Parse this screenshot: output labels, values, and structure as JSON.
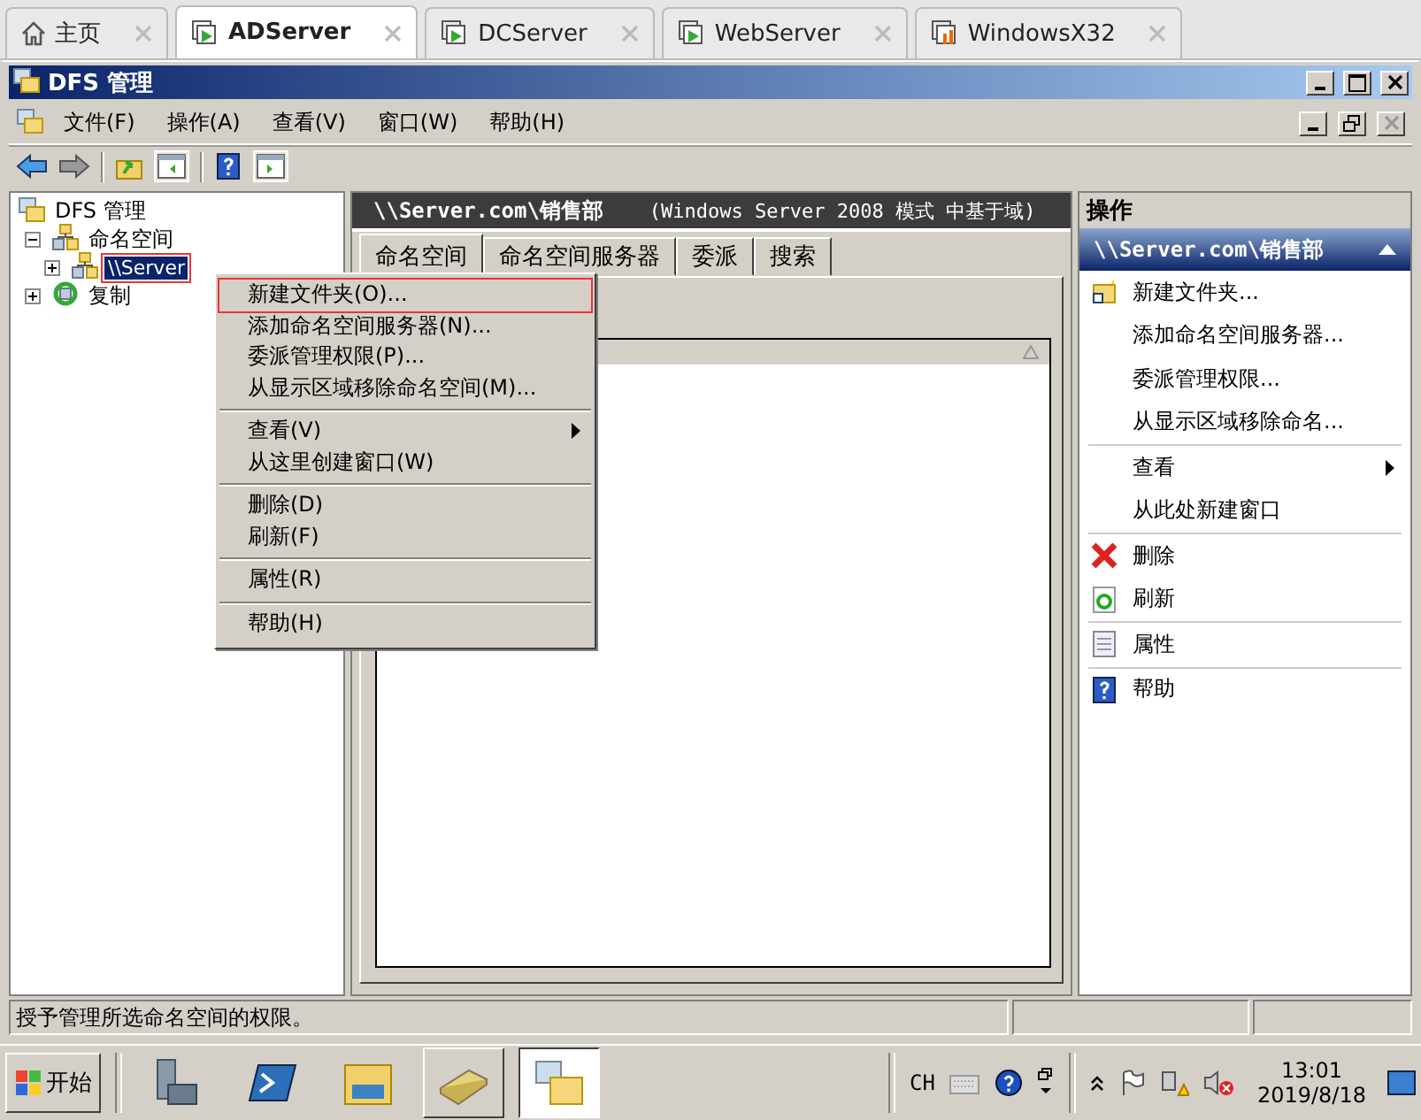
{
  "browser_tabs": [
    {
      "label": "主页",
      "kind": "home",
      "selected": false
    },
    {
      "label": "ADServer",
      "kind": "server",
      "selected": true
    },
    {
      "label": "DCServer",
      "kind": "server",
      "selected": false
    },
    {
      "label": "WebServer",
      "kind": "server",
      "selected": false
    },
    {
      "label": "WindowsX32",
      "kind": "windows",
      "selected": false
    }
  ],
  "window": {
    "title": "DFS 管理"
  },
  "menu_bar": [
    "文件(F)",
    "操作(A)",
    "查看(V)",
    "窗口(W)",
    "帮助(H)"
  ],
  "tree": [
    {
      "label": "DFS 管理",
      "kind": "root",
      "selected": false,
      "children": [
        {
          "label": "命名空间",
          "kind": "namespace",
          "selected": false,
          "expanded": true,
          "children": [
            {
              "label": "\\\\Server",
              "kind": "namespace",
              "selected": true,
              "expanded": false,
              "highlighted": true
            }
          ]
        },
        {
          "label": "复制",
          "kind": "replication",
          "selected": false,
          "expanded": false
        }
      ]
    }
  ],
  "content": {
    "title": "\\\\Server.com\\销售部",
    "subtitle": "(Windows Server 2008 模式 中基于域)",
    "tabs": [
      {
        "label": "命名空间",
        "selected": true
      },
      {
        "label": "命名空间服务器",
        "selected": false
      },
      {
        "label": "委派",
        "selected": false
      },
      {
        "label": "搜索",
        "selected": false
      }
    ]
  },
  "context_menu": [
    [
      {
        "label": "新建文件夹(O)...",
        "submenu": false,
        "highlighted": true
      },
      {
        "label": "添加命名空间服务器(N)...",
        "submenu": false,
        "highlighted": false
      },
      {
        "label": "委派管理权限(P)...",
        "submenu": false,
        "highlighted": false
      },
      {
        "label": "从显示区域移除命名空间(M)...",
        "submenu": false,
        "highlighted": false
      }
    ],
    [
      {
        "label": "查看(V)",
        "submenu": true,
        "highlighted": false
      },
      {
        "label": "从这里创建窗口(W)",
        "submenu": false,
        "highlighted": false
      }
    ],
    [
      {
        "label": "删除(D)",
        "submenu": false,
        "highlighted": false
      },
      {
        "label": "刷新(F)",
        "submenu": false,
        "highlighted": false
      }
    ],
    [
      {
        "label": "属性(R)",
        "submenu": false,
        "highlighted": false
      }
    ],
    [
      {
        "label": "帮助(H)",
        "submenu": false,
        "highlighted": false
      }
    ]
  ],
  "actions": {
    "title": "操作",
    "section": "\\\\Server.com\\销售部",
    "groups": [
      [
        {
          "label": "新建文件夹...",
          "kind": "folder",
          "submenu": false
        },
        {
          "label": "添加命名空间服务器...",
          "kind": "plain",
          "submenu": false
        },
        {
          "label": "委派管理权限...",
          "kind": "plain",
          "submenu": false
        },
        {
          "label": "从显示区域移除命名...",
          "kind": "plain",
          "submenu": false
        }
      ],
      [
        {
          "label": "查看",
          "kind": "plain",
          "submenu": true
        },
        {
          "label": "从此处新建窗口",
          "kind": "plain",
          "submenu": false
        }
      ],
      [
        {
          "label": "删除",
          "kind": "delete",
          "submenu": false
        },
        {
          "label": "刷新",
          "kind": "refresh",
          "submenu": false
        }
      ],
      [
        {
          "label": "属性",
          "kind": "properties",
          "submenu": false
        }
      ],
      [
        {
          "label": "帮助",
          "kind": "help",
          "submenu": false
        }
      ]
    ]
  },
  "status_bar": "授予管理所选命名空间的权限。",
  "taskbar": {
    "start": "开始",
    "apps": [
      {
        "kind": "server-manager",
        "running": false,
        "selected": false
      },
      {
        "kind": "powershell",
        "running": false,
        "selected": false
      },
      {
        "kind": "explorer",
        "running": false,
        "selected": false
      },
      {
        "kind": "scanner",
        "running": true,
        "selected": false
      },
      {
        "kind": "dfs",
        "running": true,
        "selected": true
      }
    ],
    "language": "CH",
    "time": "13:01",
    "date": "2019/8/18"
  }
}
